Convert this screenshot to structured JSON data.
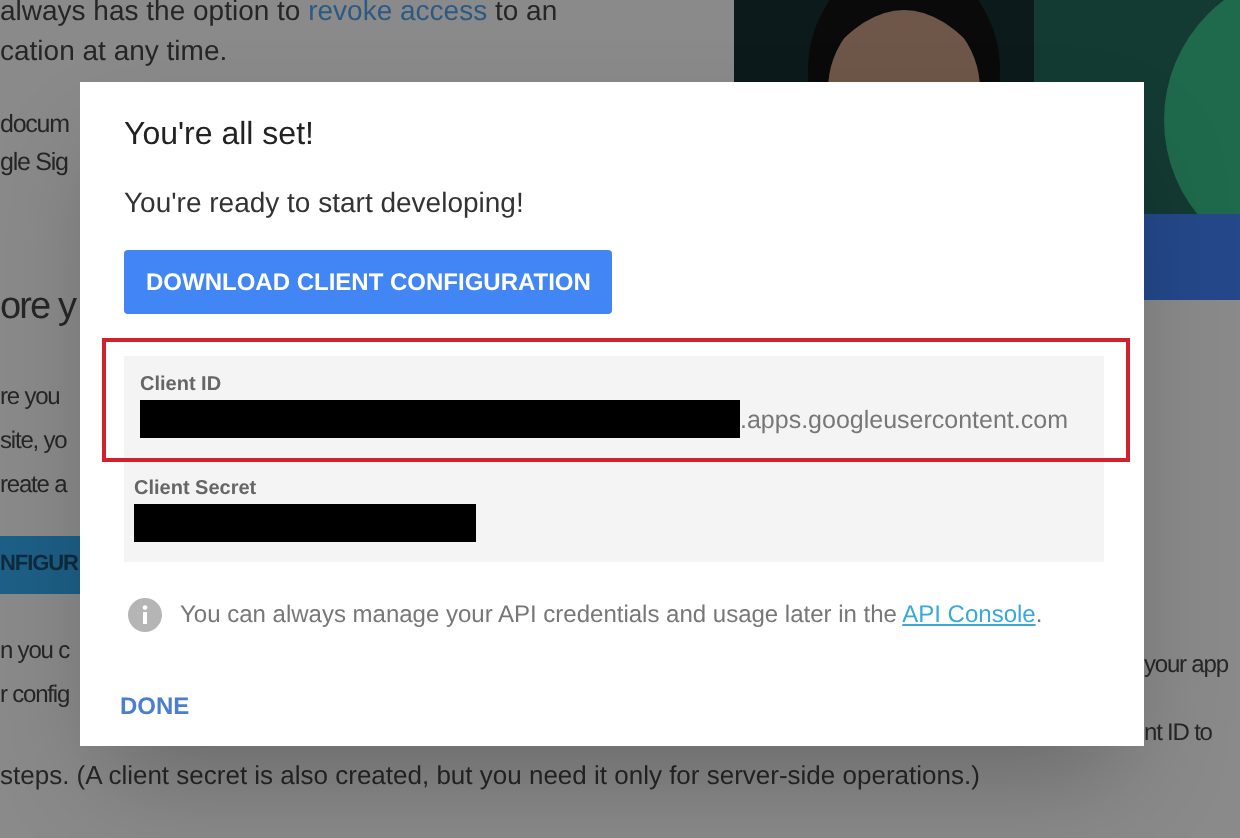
{
  "background": {
    "top_lines": [
      {
        "kind": "link_line",
        "before": "always has the option to ",
        "link": "revoke access",
        "after": " to an"
      },
      {
        "kind": "text",
        "text": "cation at any time."
      },
      {
        "kind": "text",
        "text": "docum"
      },
      {
        "kind": "text",
        "text": "gle Sig"
      }
    ],
    "left_column": [
      {
        "kind": "heading",
        "text": "ore y"
      },
      {
        "kind": "text",
        "text": "re you"
      },
      {
        "kind": "text",
        "text": "site, yo"
      },
      {
        "kind": "text",
        "text": "reate a"
      },
      {
        "kind": "button",
        "text": "NFIGUR"
      },
      {
        "kind": "text",
        "text": "n you c"
      },
      {
        "kind": "text",
        "text": "r config"
      }
    ],
    "right_column": [
      "your app",
      "nt ID to"
    ],
    "bottom_line": "steps. (A client secret is also created, but you need it only for server-side operations.)"
  },
  "dialog": {
    "title": "You're all set!",
    "message": "You're ready to start developing!",
    "download_button": "DOWNLOAD CLIENT CONFIGURATION",
    "credentials": [
      {
        "label": "Client ID",
        "suffix": ".apps.googleusercontent.com",
        "highlighted": true
      },
      {
        "label": "Client Secret",
        "highlighted": false
      }
    ],
    "note": {
      "before": "You can always manage your API credentials and usage later in the ",
      "link": "API Console",
      "after": "."
    },
    "done_button": "DONE"
  }
}
